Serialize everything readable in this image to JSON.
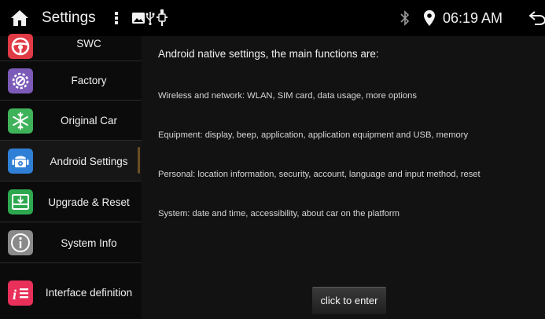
{
  "statusbar": {
    "title": "Settings",
    "time": "06:19 AM"
  },
  "sidebar": {
    "items": [
      {
        "label": "SWC",
        "icon": "steering-wheel-icon",
        "color": "#e03a45"
      },
      {
        "label": "Factory",
        "icon": "factory-gear-icon",
        "color": "#7c5ab8"
      },
      {
        "label": "Original Car",
        "icon": "snowflake-icon",
        "color": "#3fb35a"
      },
      {
        "label": "Android Settings",
        "icon": "android-icon",
        "color": "#2f7fd6"
      },
      {
        "label": "Upgrade & Reset",
        "icon": "download-icon",
        "color": "#2ea84f"
      },
      {
        "label": "System Info",
        "icon": "info-icon",
        "color": "#8a8a8a"
      },
      {
        "label": "Interface definition",
        "icon": "interface-list-icon",
        "color": "#e8305a"
      }
    ],
    "active_index": 3
  },
  "content": {
    "intro": "Android native settings, the main functions are:",
    "lines": [
      "Wireless and network: WLAN, SIM card, data usage, more options",
      "Equipment: display, beep, application, application equipment and USB, memory",
      "Personal: location information, security, account, language and input method, reset",
      "System: date and time, accessibility, about car on the platform"
    ],
    "button_label": "click to enter"
  }
}
